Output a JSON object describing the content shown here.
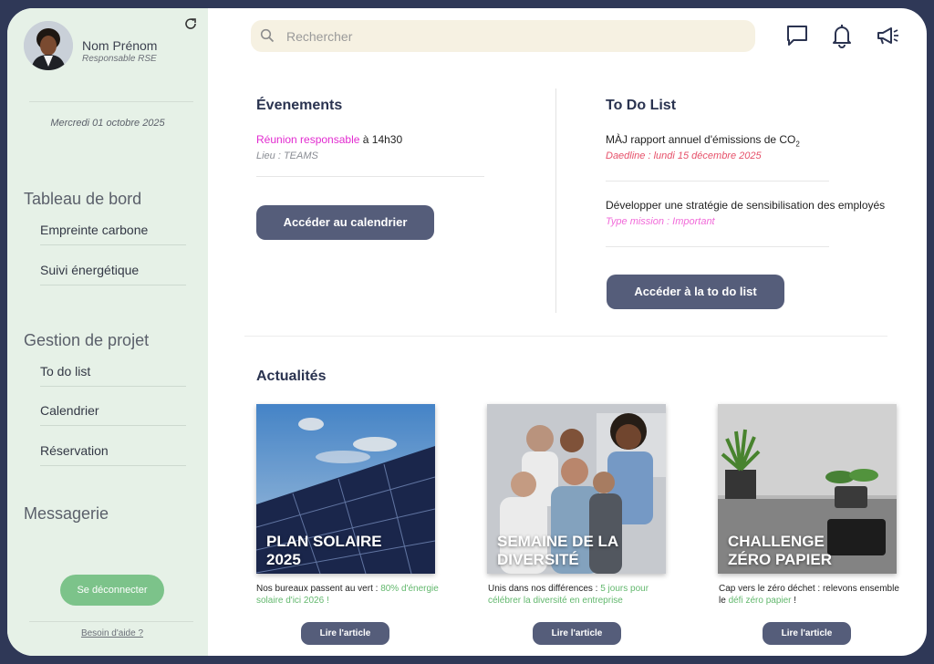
{
  "user": {
    "name": "Nom Prénom",
    "role": "Responsable RSE"
  },
  "date": "Mercredi 01 octobre 2025",
  "nav": {
    "sections": [
      {
        "title": "Tableau de bord",
        "items": [
          "Empreinte carbone",
          "Suivi énergétique"
        ]
      },
      {
        "title": "Gestion de projet",
        "items": [
          "To do list",
          "Calendrier",
          "Réservation"
        ]
      },
      {
        "title": "Messagerie",
        "items": []
      }
    ]
  },
  "logout_label": "Se déconnecter",
  "help_label": "Besoin d'aide ?",
  "search": {
    "placeholder": "Rechercher"
  },
  "icons": {
    "refresh": "refresh-icon",
    "search": "search-icon",
    "chat": "chat-icon",
    "bell": "bell-icon",
    "megaphone": "megaphone-icon"
  },
  "events": {
    "title": "Évenements",
    "item": {
      "name": "Réunion responsable",
      "time": "à 14h30",
      "place": "Lieu : TEAMS"
    },
    "button": "Accéder au calendrier"
  },
  "todo": {
    "title": "To Do List",
    "items": [
      {
        "title": "MÀJ rapport annuel d'émissions de CO",
        "subscript": "2",
        "meta": "Daedline : lundi 15 décembre 2025"
      },
      {
        "title": "Développer une stratégie de sensibilisation des employés",
        "meta": "Type mission : Important"
      }
    ],
    "button": "Accéder à la to do list"
  },
  "news": {
    "title": "Actualités",
    "cards": [
      {
        "title": "PLAN SOLAIRE 2025",
        "desc_prefix": "Nos bureaux passent au vert : ",
        "desc_highlight": "80% d'énergie solaire d'ici 2026 !",
        "desc_suffix": "",
        "button": "Lire l'article"
      },
      {
        "title": "SEMAINE DE LA DIVERSITÉ",
        "desc_prefix": "Unis dans nos différences : ",
        "desc_highlight": "5 jours pour célébrer la diversité en entreprise",
        "desc_suffix": "",
        "button": "Lire l'article"
      },
      {
        "title": "CHALLENGE ZÉRO PAPIER",
        "desc_prefix": "Cap vers le zéro déchet : relevons ensemble le ",
        "desc_highlight": "défi zéro papier",
        "desc_suffix": " !",
        "button": "Lire l'article"
      }
    ]
  },
  "colors": {
    "accent": "#555d7a",
    "sidebar": "#e6f1e7",
    "pink": "#e22bd0",
    "red": "#e6516a",
    "green": "#63b86e",
    "frame": "#2f3857"
  }
}
